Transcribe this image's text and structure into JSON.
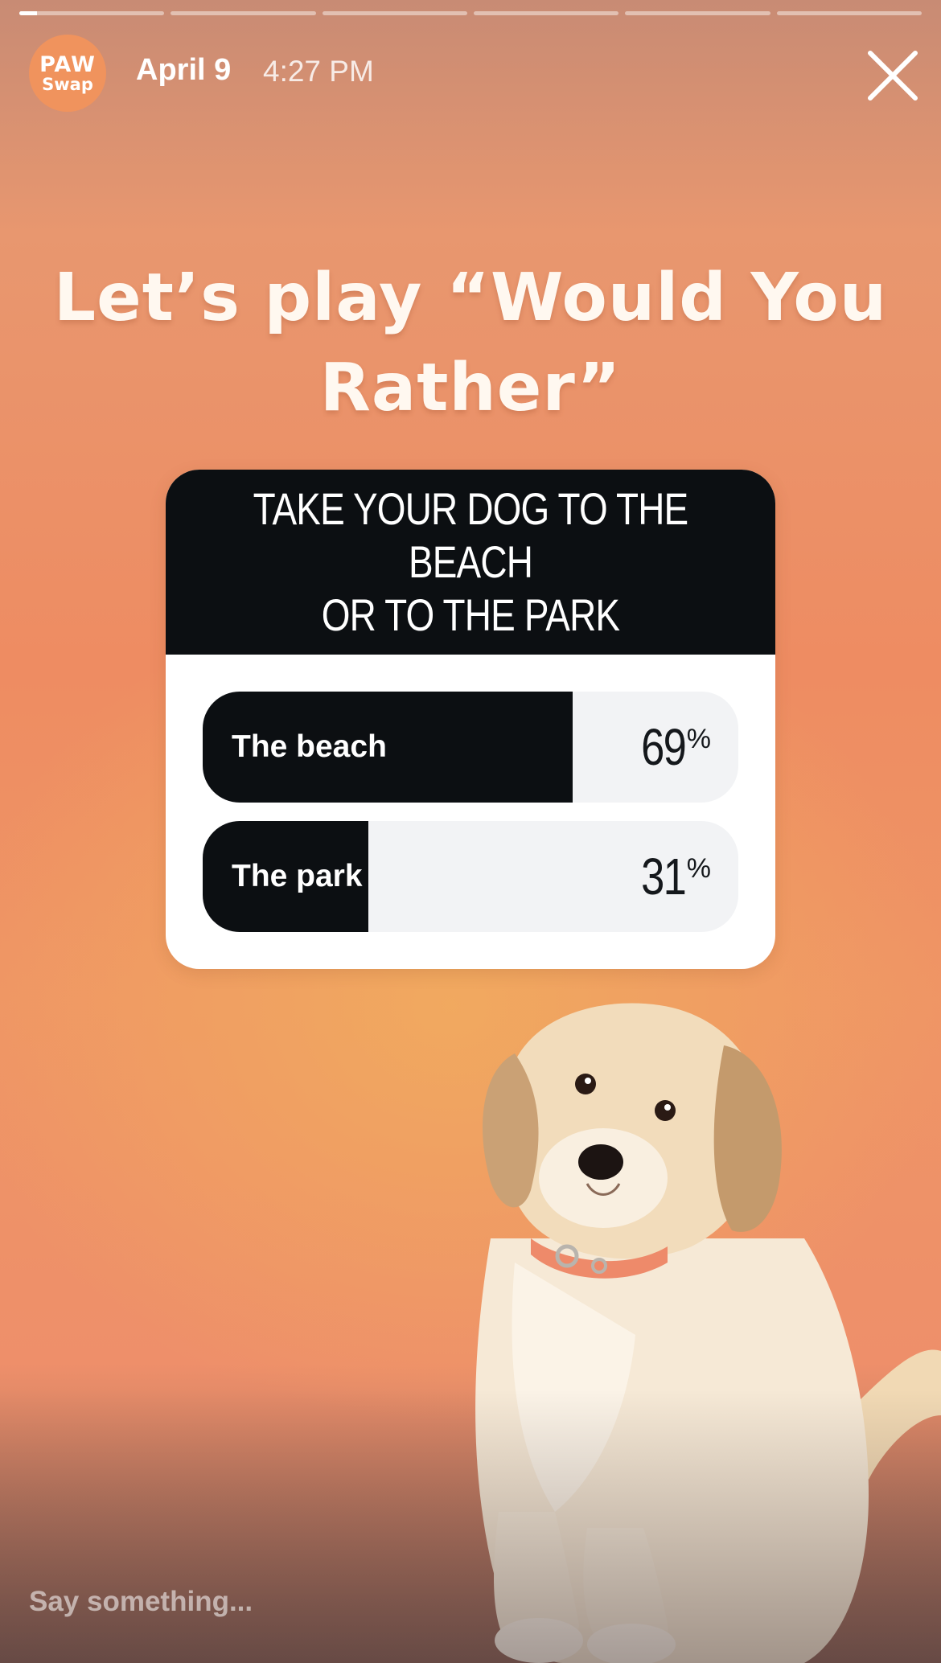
{
  "story": {
    "progress_segments": [
      {
        "filled": 0.12
      },
      {
        "filled": 0
      },
      {
        "filled": 0
      },
      {
        "filled": 0
      },
      {
        "filled": 0
      },
      {
        "filled": 0
      }
    ]
  },
  "header": {
    "avatar_line1": "PAW",
    "avatar_line2": "Swap",
    "date": "April 9",
    "time": "4:27 PM",
    "close_icon": "close-icon"
  },
  "headline": {
    "line1": "Let’s play “Would You",
    "line2": "Rather”"
  },
  "poll": {
    "question_line1": "TAKE YOUR DOG TO THE BEACH",
    "question_line2": "OR TO THE PARK",
    "options": [
      {
        "label": "The beach",
        "percent": 69,
        "percent_sign": "%"
      },
      {
        "label": "The park",
        "percent": 31,
        "percent_sign": "%"
      }
    ]
  },
  "reply": {
    "placeholder": "Say something..."
  },
  "colors": {
    "background": "#ee8c62",
    "poll_dark": "#0c0f12",
    "poll_light": "#f2f3f5",
    "avatar": "#f0935d"
  }
}
